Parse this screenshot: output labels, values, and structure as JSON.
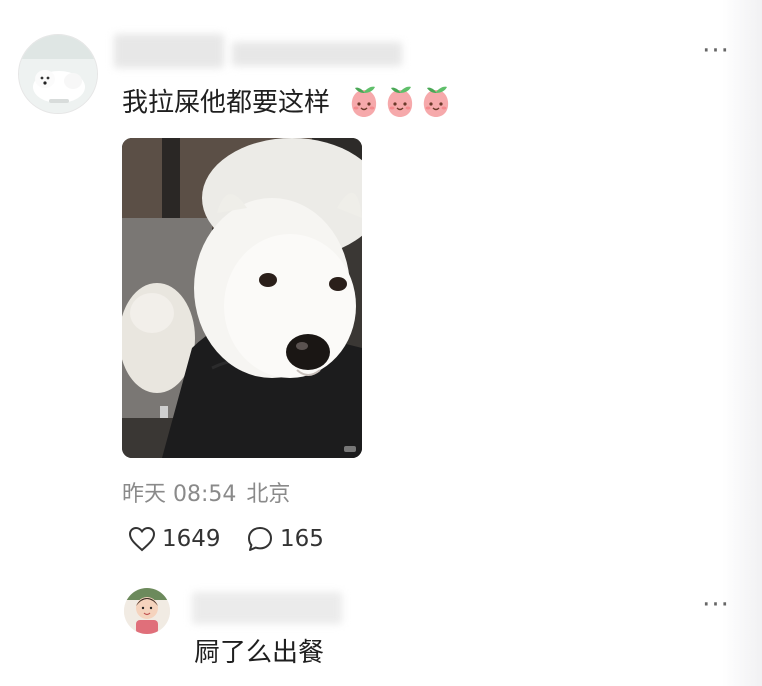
{
  "comment": {
    "text": "我拉屎他都要这样",
    "emojis": [
      "peach-face-emoji",
      "peach-face-emoji",
      "peach-face-emoji"
    ],
    "time": "昨天 08:54",
    "location": "北京",
    "likes": "1649",
    "replies": "165"
  },
  "reply": {
    "text": "屙了么出餐"
  },
  "icons": {
    "more": "more-dots-icon",
    "like": "heart-outline-icon",
    "comment": "comment-bubble-icon"
  }
}
